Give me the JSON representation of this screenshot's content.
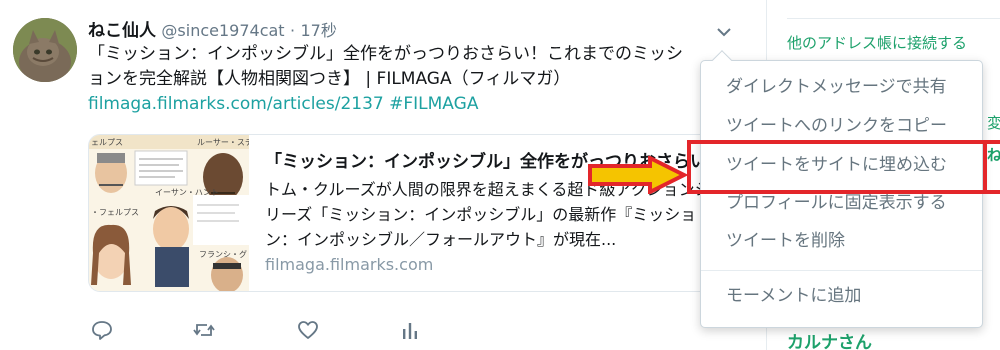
{
  "tweet": {
    "display_name": "ねこ仙人",
    "handle": "@since1974cat",
    "separator": "·",
    "timestamp": "17秒",
    "text": "「ミッション：インポッシブル」全作をがっつりおさらい！これまでのミッションを完全解説【人物相関図つき】 | FILMAGA（フィルマガ）",
    "link_text": "filmaga.filmarks.com/articles/2137 #FILMAGA"
  },
  "card": {
    "title": "「ミッション：インポッシブル」全作をがっつりおさらい！",
    "description": "トム・クルーズが人間の限界を超えまくる超ド級アクションシリーズ「ミッション：インポッシブル」の最新作『ミッション：インポッシブル／フォールアウト』が現在...",
    "domain": "filmaga.filmarks.com",
    "image_labels": [
      "ェルプス",
      "ルーサー・スティ",
      "イーサン・ハント",
      "・フェルプス",
      "フランシ・グ"
    ]
  },
  "actions": {
    "reply_icon": "reply-icon",
    "retweet_icon": "retweet-icon",
    "like_icon": "heart-icon",
    "analytics_icon": "analytics-icon"
  },
  "dropdown": {
    "items": [
      {
        "label": "ダイレクトメッセージで共有"
      },
      {
        "label": "ツイートへのリンクをコピー"
      },
      {
        "label": "ツイートをサイトに埋め込む"
      },
      {
        "label": "プロフィールに固定表示する"
      },
      {
        "label": "ツイートを削除"
      },
      {
        "label": "モーメントに追加"
      }
    ]
  },
  "sidebar": {
    "link": "他のアドレス帳に接続する",
    "fragment_1": "変",
    "fragment_2": "ね",
    "name": "カルナさん"
  },
  "colors": {
    "accent": "#1da16b",
    "highlight": "#e3262a",
    "arrow_fill": "#f5c400",
    "menu_text": "#66757f"
  }
}
